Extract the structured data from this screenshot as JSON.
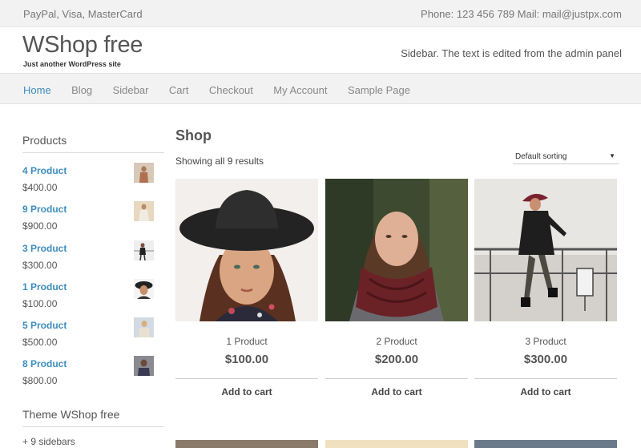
{
  "topbar": {
    "payment_text": "PayPal, Visa, MasterCard",
    "contact_text": "Phone: 123 456 789 Mail: mail@justpx.com"
  },
  "header": {
    "site_title": "WShop free",
    "tagline": "Just another WordPress site",
    "sidebar_text": "Sidebar. The text is edited from the admin panel"
  },
  "nav": {
    "items": [
      {
        "label": "Home",
        "active": true
      },
      {
        "label": "Blog"
      },
      {
        "label": "Sidebar"
      },
      {
        "label": "Cart"
      },
      {
        "label": "Checkout"
      },
      {
        "label": "My Account"
      },
      {
        "label": "Sample Page"
      }
    ]
  },
  "sidebar": {
    "products_title": "Products",
    "products": [
      {
        "name": "4 Product",
        "price": "$400.00"
      },
      {
        "name": "9 Product",
        "price": "$900.00"
      },
      {
        "name": "3 Product",
        "price": "$300.00"
      },
      {
        "name": "1 Product",
        "price": "$100.00"
      },
      {
        "name": "5 Product",
        "price": "$500.00"
      },
      {
        "name": "8 Product",
        "price": "$800.00"
      }
    ],
    "theme_title": "Theme WShop free",
    "theme_text": "+ 9 sidebars"
  },
  "shop": {
    "title": "Shop",
    "result_count": "Showing all 9 results",
    "sorting": "Default sorting",
    "products": [
      {
        "name": "1 Product",
        "price": "$100.00",
        "button": "Add to cart"
      },
      {
        "name": "2 Product",
        "price": "$200.00",
        "button": "Add to cart"
      },
      {
        "name": "3 Product",
        "price": "$300.00",
        "button": "Add to cart"
      }
    ]
  },
  "colors": {
    "accent": "#3d8dbd",
    "topbar_bg": "#f2f2f2",
    "text": "#555555"
  }
}
